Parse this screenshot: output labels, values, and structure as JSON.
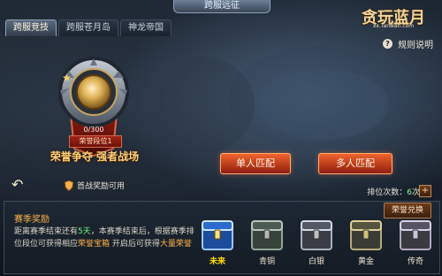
{
  "header": {
    "title": "跨服远征"
  },
  "tabs": [
    {
      "label": "跨服竞技",
      "active": true
    },
    {
      "label": "跨服苍月岛",
      "active": false
    },
    {
      "label": "神龙帝国",
      "active": false
    }
  ],
  "logo": {
    "title": "贪玩蓝月",
    "subtitle": "xx.Tanwan.com"
  },
  "help": {
    "label": "规则说明",
    "icon": "question-icon"
  },
  "rank": {
    "progress_text": "0/300",
    "rank_name": "荣誉段位1",
    "slogan": "荣誉争夺 强者战场"
  },
  "actions": {
    "single_match": "单人匹配",
    "multi_match": "多人匹配"
  },
  "first_win": {
    "text": "首战奖励可用"
  },
  "rank_count": {
    "label": "排位次数：",
    "value": "6",
    "unit": "次"
  },
  "season": {
    "title": "赛季奖励",
    "desc_part1": "距离赛季结束还有",
    "days": "5天",
    "desc_part2": "，本赛季结束后，根据赛季排位段位可获得相应",
    "reward_name": "荣誉宝箱",
    "desc_part3": "开启后可获得",
    "reward_amount": "大量荣誉"
  },
  "shop_button": "荣誉兑换",
  "chests": [
    {
      "label": "未来",
      "highlight": true
    },
    {
      "label": "青铜",
      "highlight": false
    },
    {
      "label": "白银",
      "highlight": false
    },
    {
      "label": "黄金",
      "highlight": false
    },
    {
      "label": "传奇",
      "highlight": false
    }
  ],
  "colors": {
    "accent_red": "#d8452a",
    "gold": "#f1d29a",
    "green_text": "#6bff7b",
    "orange_text": "#ffb14a"
  }
}
